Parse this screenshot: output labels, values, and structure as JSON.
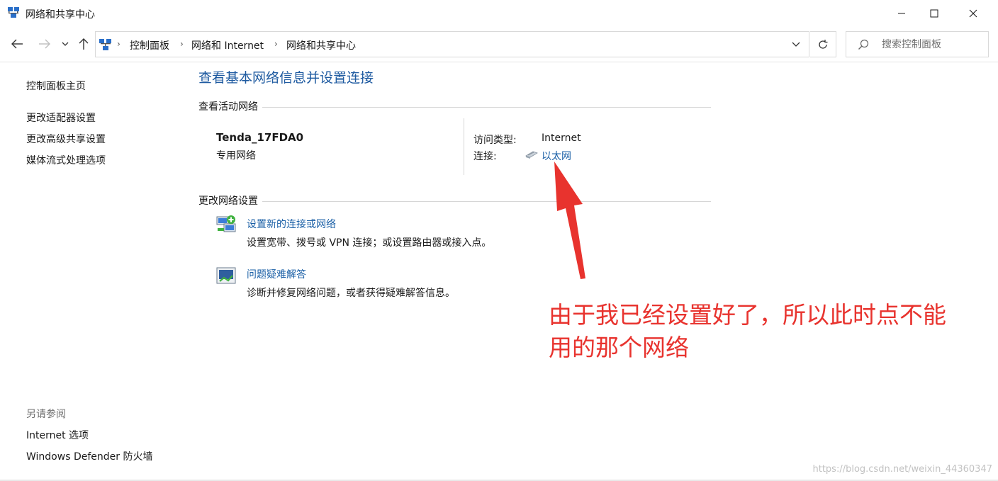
{
  "window": {
    "title": "网络和共享中心",
    "controls": {
      "minimize": "minimize-icon",
      "maximize": "maximize-icon",
      "close": "close-icon"
    }
  },
  "navigation": {
    "back": "arrow-left-icon",
    "forward": "arrow-right-icon",
    "recent": "chevron-down-icon",
    "up": "arrow-up-icon"
  },
  "address": {
    "breadcrumbs": [
      "控制面板",
      "网络和 Internet",
      "网络和共享中心"
    ],
    "separator": "›"
  },
  "search": {
    "placeholder": "搜索控制面板"
  },
  "sidebar": {
    "home": "控制面板主页",
    "links": [
      "更改适配器设置",
      "更改高级共享设置",
      "媒体流式处理选项"
    ],
    "see_also_title": "另请参阅",
    "see_also": [
      "Internet 选项",
      "Windows Defender 防火墙"
    ]
  },
  "main": {
    "title": "查看基本网络信息并设置连接",
    "active_networks_header": "查看活动网络",
    "network": {
      "name": "Tenda_17FDA0",
      "type": "专用网络",
      "access_type_label": "访问类型:",
      "access_type_value": "Internet",
      "connection_label": "连接:",
      "connection_value": "以太网"
    },
    "change_settings_header": "更改网络设置",
    "tasks": [
      {
        "title": "设置新的连接或网络",
        "description": "设置宽带、拨号或 VPN 连接；或设置路由器或接入点。"
      },
      {
        "title": "问题疑难解答",
        "description": "诊断并修复网络问题，或者获得疑难解答信息。"
      }
    ]
  },
  "annotation": {
    "line1": "由于我已经设置好了，所以此时点不能",
    "line2": "用的那个网络",
    "color": "#e8332e"
  },
  "watermark": "https://blog.csdn.net/weixin_44360347",
  "colors": {
    "link": "#1a5fa6",
    "title": "#1e5aa0"
  }
}
